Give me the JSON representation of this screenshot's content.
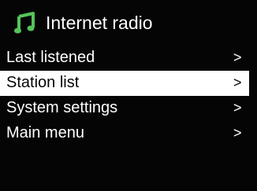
{
  "screen": {
    "title": "Internet radio",
    "title_icon": "music-note-icon",
    "accent_color": "#55c35a",
    "background_color": "#050505",
    "highlight_color": "#ffffff"
  },
  "menu": {
    "items": [
      {
        "label": "Last listened",
        "arrow": ">",
        "selected": false
      },
      {
        "label": "Station list",
        "arrow": ">",
        "selected": true
      },
      {
        "label": "System settings",
        "arrow": ">",
        "selected": false
      },
      {
        "label": "Main menu",
        "arrow": ">",
        "selected": false
      }
    ]
  }
}
